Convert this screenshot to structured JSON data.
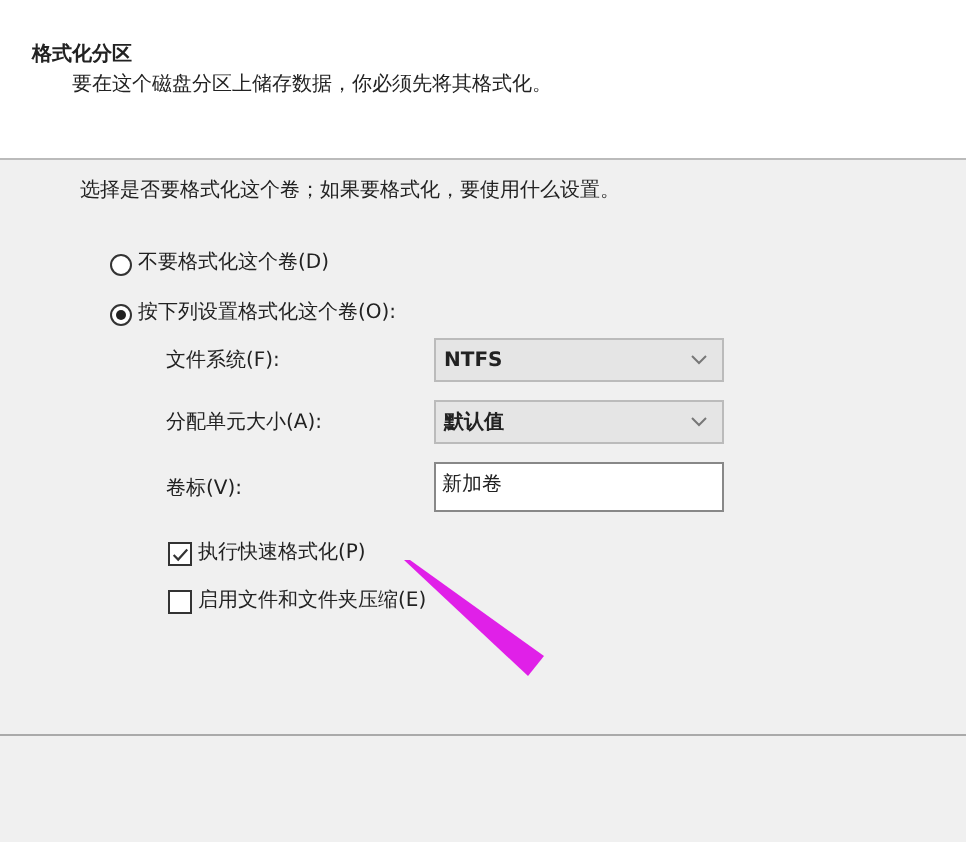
{
  "header": {
    "heading": "格式化分区",
    "description": "要在这个磁盘分区上储存数据，你必须先将其格式化。"
  },
  "prompt": "选择是否要格式化这个卷；如果要格式化，要使用什么设置。",
  "format_options": [
    {
      "label": "不要格式化这个卷(D)",
      "selected": false
    },
    {
      "label": "按下列设置格式化这个卷(O):",
      "selected": true
    }
  ],
  "settings": [
    {
      "kind": "dropdown",
      "label": "文件系统(F):",
      "value": "NTFS"
    },
    {
      "kind": "dropdown",
      "label": "分配单元大小(A):",
      "value": "默认值"
    },
    {
      "kind": "text",
      "label": "卷标(V):",
      "value": "新加卷"
    }
  ],
  "checkboxes": [
    {
      "label": "执行快速格式化(P)",
      "checked": true
    },
    {
      "label": "启用文件和文件夹压缩(E)",
      "checked": false
    }
  ]
}
